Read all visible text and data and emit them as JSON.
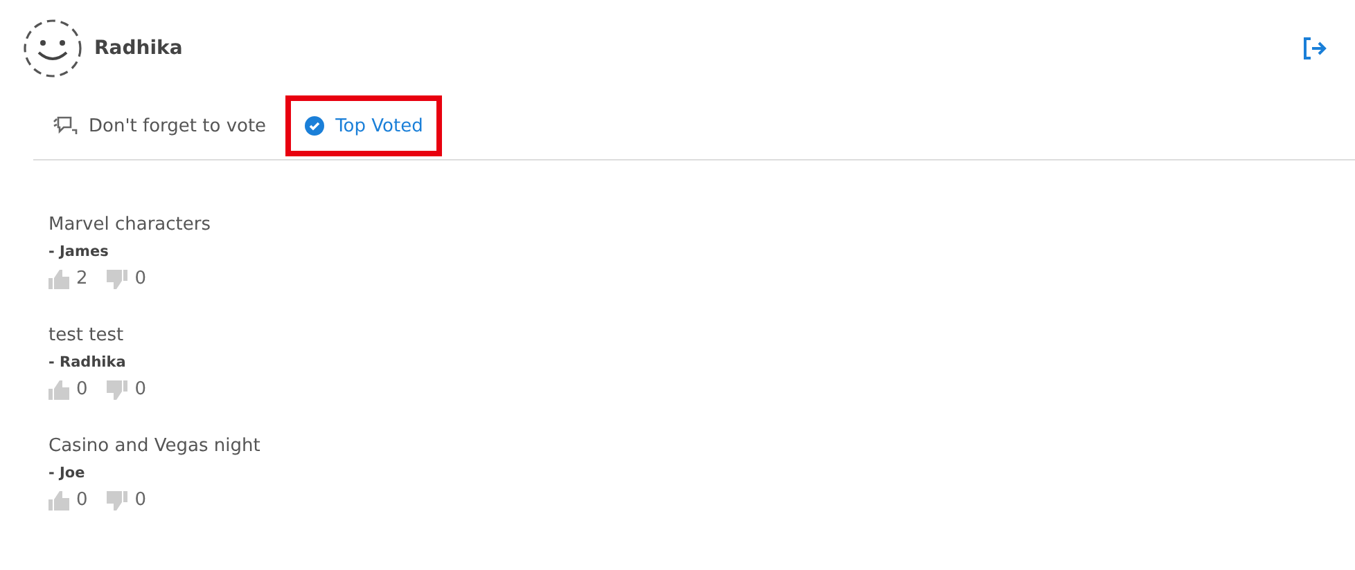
{
  "user": {
    "name": "Radhika"
  },
  "tabs": [
    {
      "label": "Don't forget to vote",
      "selected": false,
      "kind": "chat"
    },
    {
      "label": "Top Voted",
      "selected": true,
      "kind": "check"
    }
  ],
  "posts": [
    {
      "title": "Marvel characters",
      "author": "- James",
      "likes": "2",
      "dislikes": "0"
    },
    {
      "title": "test test",
      "author": "- Radhika",
      "likes": "0",
      "dislikes": "0"
    },
    {
      "title": "Casino and Vegas night",
      "author": "- Joe",
      "likes": "0",
      "dislikes": "0"
    }
  ]
}
